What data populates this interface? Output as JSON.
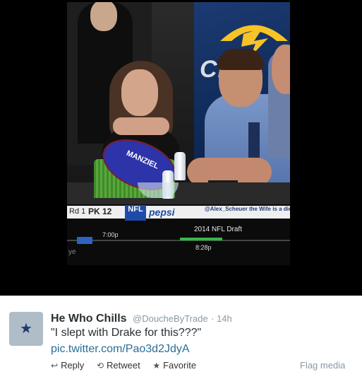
{
  "media": {
    "ticker": {
      "round_label": "Rd 1",
      "pick_label": "PK 12",
      "network_badge": "NFL",
      "sponsor_text": "pepsi",
      "scroll_text": "@Alex_Scheuer the Wife is a die ha... I'm not making fun of her...",
      "broadcast_title": "2014 NFL Draft",
      "time_left": "7:00p",
      "time_right": "8:28p",
      "partial_text": "ye"
    },
    "stage_logo_text": "CH",
    "football_label": "MANZIEL"
  },
  "tweet": {
    "display_name": "He Who Chills",
    "handle": "@DoucheByTrade",
    "separator": " · ",
    "timestamp": "14h",
    "text": "\"I slept with Drake for this???\"",
    "media_link": "pic.twitter.com/Pao3d2JdyA",
    "actions": [
      {
        "label": "Reply",
        "icon": "reply-icon"
      },
      {
        "label": "Retweet",
        "icon": "retweet-icon"
      },
      {
        "label": "Favorite",
        "icon": "star-icon"
      }
    ],
    "flag_label": "Flag media"
  },
  "colors": {
    "link": "#2a6e98",
    "muted": "#8899a6",
    "text": "#292f33",
    "avatar_bg": "#aebdc7",
    "star": "#1f3b6e"
  }
}
